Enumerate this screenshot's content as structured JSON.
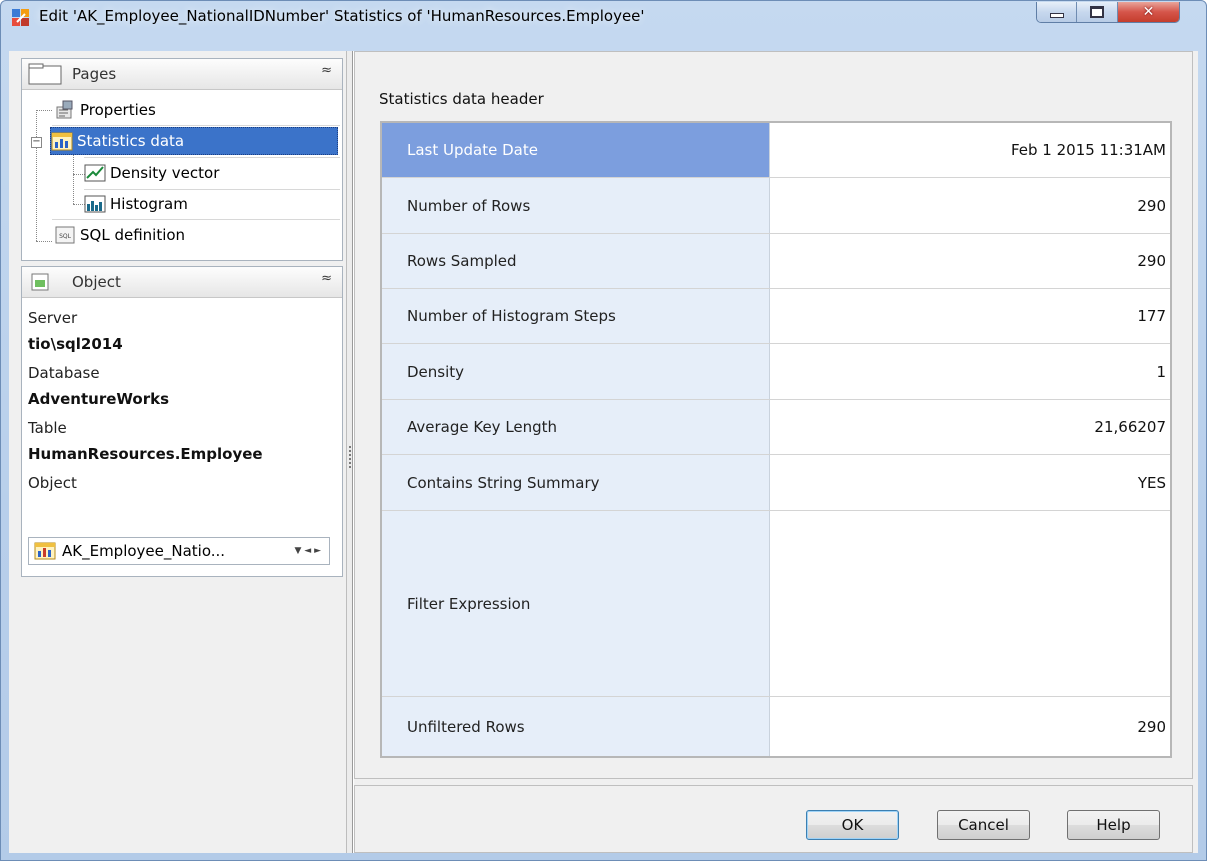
{
  "window": {
    "title": "Edit 'AK_Employee_NationalIDNumber' Statistics of 'HumanResources.Employee'",
    "close_glyph": "✕"
  },
  "pages": {
    "header": "Pages",
    "collapse_glyph": "≈",
    "items": [
      {
        "label": "Properties",
        "icon": "properties-icon"
      },
      {
        "label": "Statistics data",
        "icon": "statistics-icon",
        "selected": true
      },
      {
        "label": "Density vector",
        "icon": "density-vector-icon"
      },
      {
        "label": "Histogram",
        "icon": "histogram-icon"
      },
      {
        "label": "SQL definition",
        "icon": "sql-icon"
      }
    ],
    "expander_glyph": "−"
  },
  "object": {
    "header": "Object",
    "collapse_glyph": "≈",
    "server_label": "Server",
    "server_value": "tio\\sql2014",
    "database_label": "Database",
    "database_value": "AdventureWorks",
    "table_label": "Table",
    "table_value": "HumanResources.Employee",
    "object_label": "Object",
    "object_value": "AK_Employee_Natio...",
    "combo_arrows": "▼  ◄  ►"
  },
  "statistics": {
    "caption": "Statistics data header",
    "rows": [
      {
        "name": "Last Update Date",
        "value": "Feb  1 2015 11:31AM"
      },
      {
        "name": "Number of Rows",
        "value": "290"
      },
      {
        "name": "Rows Sampled",
        "value": "290"
      },
      {
        "name": "Number of Histogram Steps",
        "value": "177"
      },
      {
        "name": "Density",
        "value": "1"
      },
      {
        "name": "Average Key Length",
        "value": "21,66207"
      },
      {
        "name": "Contains String Summary",
        "value": "YES"
      },
      {
        "name": "Filter Expression",
        "value": ""
      },
      {
        "name": "Unfiltered Rows",
        "value": "290"
      }
    ]
  },
  "buttons": {
    "ok": "OK",
    "cancel": "Cancel",
    "help": "Help"
  },
  "colors": {
    "selection": "#3b73c9",
    "grid_selected": "#7c9ede",
    "grid_name_bg": "#e6eef9"
  }
}
